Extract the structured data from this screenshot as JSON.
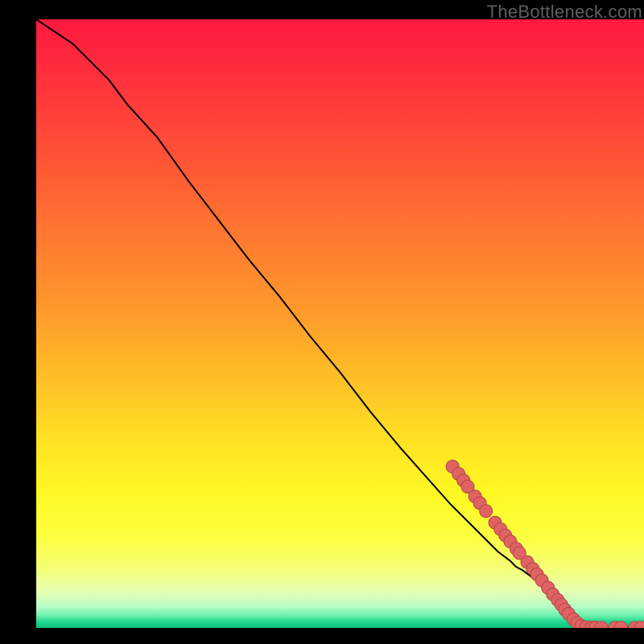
{
  "watermark": "TheBottleneck.com",
  "chart_data": {
    "type": "line",
    "title": "",
    "xlabel": "",
    "ylabel": "",
    "xlim": [
      0,
      100
    ],
    "ylim": [
      0,
      100
    ],
    "curve": [
      {
        "x": 0,
        "y": 100
      },
      {
        "x": 3,
        "y": 98
      },
      {
        "x": 6,
        "y": 96
      },
      {
        "x": 9,
        "y": 93
      },
      {
        "x": 12,
        "y": 90
      },
      {
        "x": 15,
        "y": 86
      },
      {
        "x": 20,
        "y": 80.5
      },
      {
        "x": 25,
        "y": 73.5
      },
      {
        "x": 30,
        "y": 67
      },
      {
        "x": 35,
        "y": 60.5
      },
      {
        "x": 40,
        "y": 54.5
      },
      {
        "x": 45,
        "y": 48
      },
      {
        "x": 50,
        "y": 42
      },
      {
        "x": 55,
        "y": 35.5
      },
      {
        "x": 60,
        "y": 29.5
      },
      {
        "x": 64,
        "y": 25
      },
      {
        "x": 68,
        "y": 20.5
      },
      {
        "x": 72,
        "y": 16.5
      },
      {
        "x": 74,
        "y": 14.5
      },
      {
        "x": 76,
        "y": 12.5
      },
      {
        "x": 78,
        "y": 11
      },
      {
        "x": 79,
        "y": 10
      },
      {
        "x": 80,
        "y": 9.5
      },
      {
        "x": 82,
        "y": 8
      },
      {
        "x": 83,
        "y": 7
      },
      {
        "x": 84,
        "y": 6
      },
      {
        "x": 85,
        "y": 5
      },
      {
        "x": 86,
        "y": 3.7
      },
      {
        "x": 87,
        "y": 2.5
      },
      {
        "x": 88,
        "y": 1.5
      },
      {
        "x": 89,
        "y": 0.6
      },
      {
        "x": 90,
        "y": 0.15
      },
      {
        "x": 92,
        "y": 0.05
      },
      {
        "x": 95,
        "y": 0.04
      },
      {
        "x": 98,
        "y": 0.04
      },
      {
        "x": 100,
        "y": 0.04
      }
    ],
    "points": [
      {
        "x": 68.5,
        "y": 26.5
      },
      {
        "x": 69.5,
        "y": 25.3
      },
      {
        "x": 70.3,
        "y": 24.2
      },
      {
        "x": 71.0,
        "y": 23.2
      },
      {
        "x": 72.2,
        "y": 21.6
      },
      {
        "x": 73.0,
        "y": 20.5
      },
      {
        "x": 74.0,
        "y": 19.2
      },
      {
        "x": 75.5,
        "y": 17.3
      },
      {
        "x": 76.4,
        "y": 16.2
      },
      {
        "x": 77.2,
        "y": 15.2
      },
      {
        "x": 78.0,
        "y": 14.2
      },
      {
        "x": 79.0,
        "y": 13.0
      },
      {
        "x": 79.5,
        "y": 12.3
      },
      {
        "x": 80.8,
        "y": 10.8
      },
      {
        "x": 81.7,
        "y": 9.7
      },
      {
        "x": 82.4,
        "y": 8.8
      },
      {
        "x": 83.2,
        "y": 7.8
      },
      {
        "x": 84.2,
        "y": 6.6
      },
      {
        "x": 85.0,
        "y": 5.5
      },
      {
        "x": 85.8,
        "y": 4.6
      },
      {
        "x": 86.4,
        "y": 3.8
      },
      {
        "x": 87.0,
        "y": 3.0
      },
      {
        "x": 87.6,
        "y": 2.3
      },
      {
        "x": 88.4,
        "y": 1.4
      },
      {
        "x": 89.0,
        "y": 0.8
      },
      {
        "x": 89.7,
        "y": 0.3
      },
      {
        "x": 90.5,
        "y": 0.1
      },
      {
        "x": 91.4,
        "y": 0.05
      },
      {
        "x": 92.0,
        "y": 0.05
      },
      {
        "x": 93.0,
        "y": 0.04
      },
      {
        "x": 95.2,
        "y": 0.04
      },
      {
        "x": 96.2,
        "y": 0.04
      },
      {
        "x": 98.5,
        "y": 0.04
      },
      {
        "x": 99.5,
        "y": 0.04
      }
    ]
  }
}
